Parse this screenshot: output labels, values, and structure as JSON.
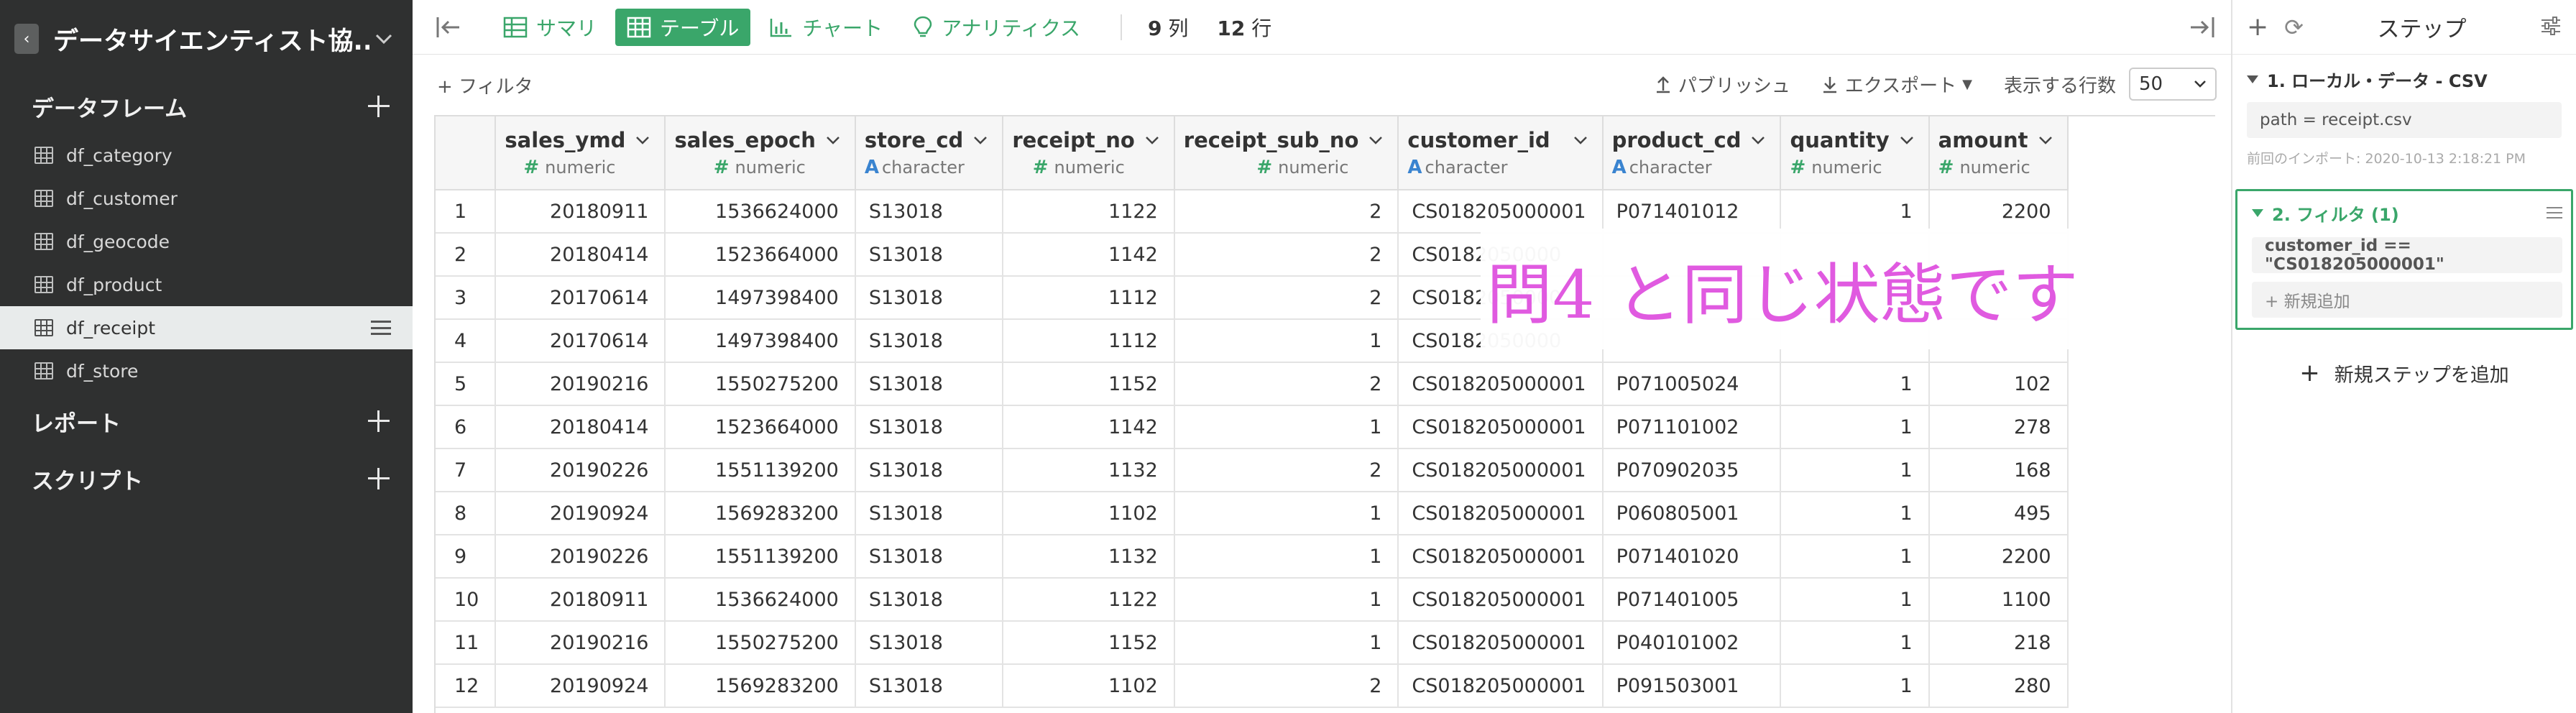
{
  "sidebar": {
    "project_title": "データサイエンティスト協...",
    "dataframes_label": "データフレーム",
    "dataframes": [
      {
        "label": "df_category"
      },
      {
        "label": "df_customer"
      },
      {
        "label": "df_geocode"
      },
      {
        "label": "df_product"
      },
      {
        "label": "df_receipt",
        "active": true
      },
      {
        "label": "df_store"
      }
    ],
    "reports_label": "レポート",
    "scripts_label": "スクリプト"
  },
  "toolbar": {
    "summary_label": "サマリ",
    "table_label": "テーブル",
    "chart_label": "チャート",
    "analytics_label": "アナリティクス",
    "col_count_num": "9",
    "col_count_unit": "列",
    "row_count_num": "12",
    "row_count_unit": "行"
  },
  "subbar": {
    "filter_label": "+ フィルタ",
    "publish_label": "パブリッシュ",
    "export_label": "エクスポート",
    "rows_label": "表示する行数",
    "rows_value": "50"
  },
  "table": {
    "columns": [
      {
        "name": "sales_ymd",
        "type": "numeric"
      },
      {
        "name": "sales_epoch",
        "type": "numeric"
      },
      {
        "name": "store_cd",
        "type": "character"
      },
      {
        "name": "receipt_no",
        "type": "numeric"
      },
      {
        "name": "receipt_sub_no",
        "type": "numeric"
      },
      {
        "name": "customer_id",
        "type": "character"
      },
      {
        "name": "product_cd",
        "type": "character"
      },
      {
        "name": "quantity",
        "type": "numeric"
      },
      {
        "name": "amount",
        "type": "numeric"
      }
    ],
    "rows": [
      [
        "1",
        "20180911",
        "1536624000",
        "S13018",
        "1122",
        "2",
        "CS018205000001",
        "P071401012",
        "1",
        "2200"
      ],
      [
        "2",
        "20180414",
        "1523664000",
        "S13018",
        "1142",
        "2",
        "CS0182050000",
        "",
        "",
        ""
      ],
      [
        "3",
        "20170614",
        "1497398400",
        "S13018",
        "1112",
        "2",
        "CS0182050000",
        "",
        "",
        ""
      ],
      [
        "4",
        "20170614",
        "1497398400",
        "S13018",
        "1112",
        "1",
        "CS0182050000",
        "",
        "",
        ""
      ],
      [
        "5",
        "20190216",
        "1550275200",
        "S13018",
        "1152",
        "2",
        "CS018205000001",
        "P071005024",
        "1",
        "102"
      ],
      [
        "6",
        "20180414",
        "1523664000",
        "S13018",
        "1142",
        "1",
        "CS018205000001",
        "P071101002",
        "1",
        "278"
      ],
      [
        "7",
        "20190226",
        "1551139200",
        "S13018",
        "1132",
        "2",
        "CS018205000001",
        "P070902035",
        "1",
        "168"
      ],
      [
        "8",
        "20190924",
        "1569283200",
        "S13018",
        "1102",
        "1",
        "CS018205000001",
        "P060805001",
        "1",
        "495"
      ],
      [
        "9",
        "20190226",
        "1551139200",
        "S13018",
        "1132",
        "1",
        "CS018205000001",
        "P071401020",
        "1",
        "2200"
      ],
      [
        "10",
        "20180911",
        "1536624000",
        "S13018",
        "1122",
        "1",
        "CS018205000001",
        "P071401005",
        "1",
        "1100"
      ],
      [
        "11",
        "20190216",
        "1550275200",
        "S13018",
        "1152",
        "1",
        "CS018205000001",
        "P040101002",
        "1",
        "218"
      ],
      [
        "12",
        "20190924",
        "1569283200",
        "S13018",
        "1102",
        "2",
        "CS018205000001",
        "P091503001",
        "1",
        "280"
      ]
    ]
  },
  "overlay_text": "問4 と同じ状態です",
  "panel": {
    "title": "ステップ",
    "step1_title": "1. ローカル・データ - CSV",
    "step1_path": "path = receipt.csv",
    "step1_note": "前回のインポート: 2020-10-13 2:18:21 PM",
    "step2_title": "2. フィルタ (1)",
    "step2_condition": "customer_id == \"CS018205000001\"",
    "step2_add": "+ 新規追加",
    "add_step_label": "新規ステップを追加"
  },
  "colors": {
    "accent_green": "#3aa66a",
    "sidebar_bg": "#2f3030",
    "overlay_text": "#e05ae0",
    "character_type": "#3a84d0"
  }
}
